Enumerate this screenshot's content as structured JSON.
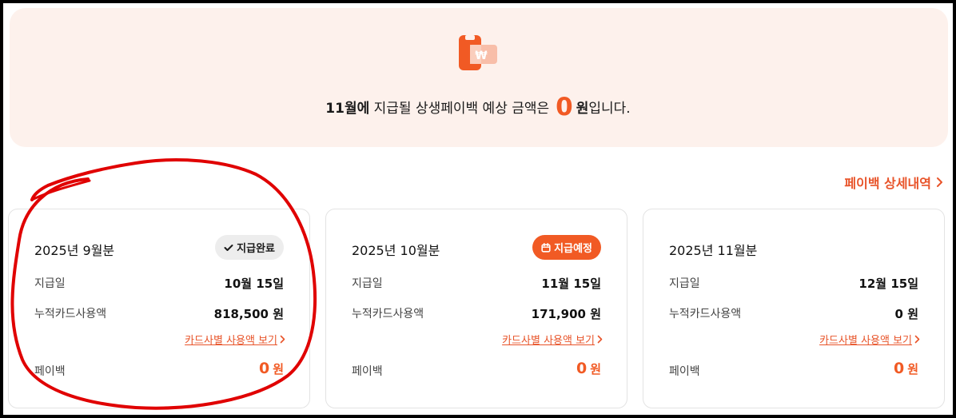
{
  "banner": {
    "month_prefix": "11월에",
    "text_before": " 지급될 상생페이백 예상 금액은",
    "amount": "0",
    "unit": "원",
    "text_after": "입니다.",
    "icon": "payback-wallet-icon"
  },
  "detail_link": {
    "label": "페이백 상세내역"
  },
  "cards": [
    {
      "title": "2025년 9월분",
      "badge": "지급완료",
      "badge_type": "done",
      "pay_date_label": "지급일",
      "pay_date": "10월 15일",
      "usage_label": "누적카드사용액",
      "usage_value": "818,500 원",
      "card_link": "카드사별 사용액 보기",
      "payback_label": "페이백",
      "payback_amount": "0",
      "payback_unit": "원"
    },
    {
      "title": "2025년 10월분",
      "badge": "지급예정",
      "badge_type": "scheduled",
      "pay_date_label": "지급일",
      "pay_date": "11월 15일",
      "usage_label": "누적카드사용액",
      "usage_value": "171,900 원",
      "card_link": "카드사별 사용액 보기",
      "payback_label": "페이백",
      "payback_amount": "0",
      "payback_unit": "원"
    },
    {
      "title": "2025년 11월분",
      "pay_date_label": "지급일",
      "pay_date": "12월 15일",
      "usage_label": "누적카드사용액",
      "usage_value": "0 원",
      "card_link": "카드사별 사용액 보기",
      "payback_label": "페이백",
      "payback_amount": "0",
      "payback_unit": "원"
    }
  ],
  "colors": {
    "accent": "#f15a24",
    "link": "#e8542a",
    "banner_bg": "#fdf1ec",
    "annotation": "#e00000"
  }
}
